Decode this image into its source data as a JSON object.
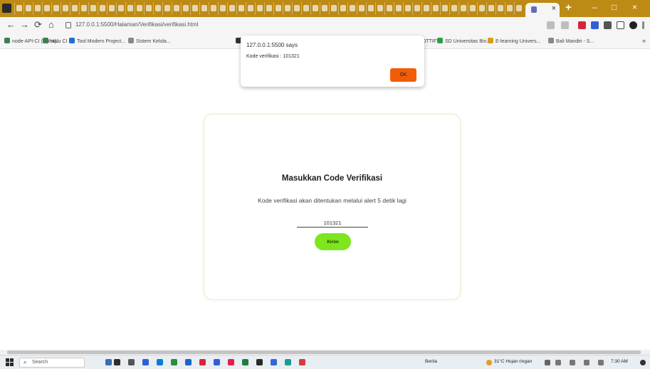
{
  "browser": {
    "tab_close_glyph": "×",
    "new_tab_glyph": "+",
    "window_controls": {
      "minimize": "–",
      "maximize": "□",
      "close": "×"
    },
    "nav": {
      "back": "←",
      "forward": "→",
      "reload": "⟳",
      "home": "⌂"
    },
    "url": "127.0.0.1:5500/Halaman/Verifikasi/verifikasi.html",
    "bookmarks": [
      {
        "label": "node-API-CI (alpha)...",
        "color": "#3d7f4f"
      },
      {
        "label": "Halo CI",
        "color": "#3d7f4f"
      },
      {
        "label": "Tool Modern Project...",
        "color": "#1f6fd1"
      },
      {
        "label": "Sistem Kelola...",
        "color": "#888888"
      },
      {
        "label": "",
        "color": "#333333"
      },
      {
        "label": "LOTTIFY",
        "color": "#666666"
      },
      {
        "label": "SD Universitas Bin...",
        "color": "#2e9e45"
      },
      {
        "label": "E-learning Univers...",
        "color": "#d4a017"
      },
      {
        "label": "Bali Mandiri - S...",
        "color": "#888888"
      }
    ],
    "bookmarks_more": "»"
  },
  "alert": {
    "origin": "127.0.0.1:5500 says",
    "message": "Kode verifikasi : 101321",
    "ok_label": "OK"
  },
  "page": {
    "title": "Masukkan Code Verifikasi",
    "description": "Kode verifikasi akan ditentukan melalui alert 5 detik lagi",
    "code_value": "101321",
    "submit_label": "Kirim"
  },
  "taskbar": {
    "search_placeholder": "Search",
    "search_glyph": "⌕",
    "news_label": "Berita",
    "weather": "31°C  Hujan ringan",
    "clock": "7:30 AM"
  }
}
